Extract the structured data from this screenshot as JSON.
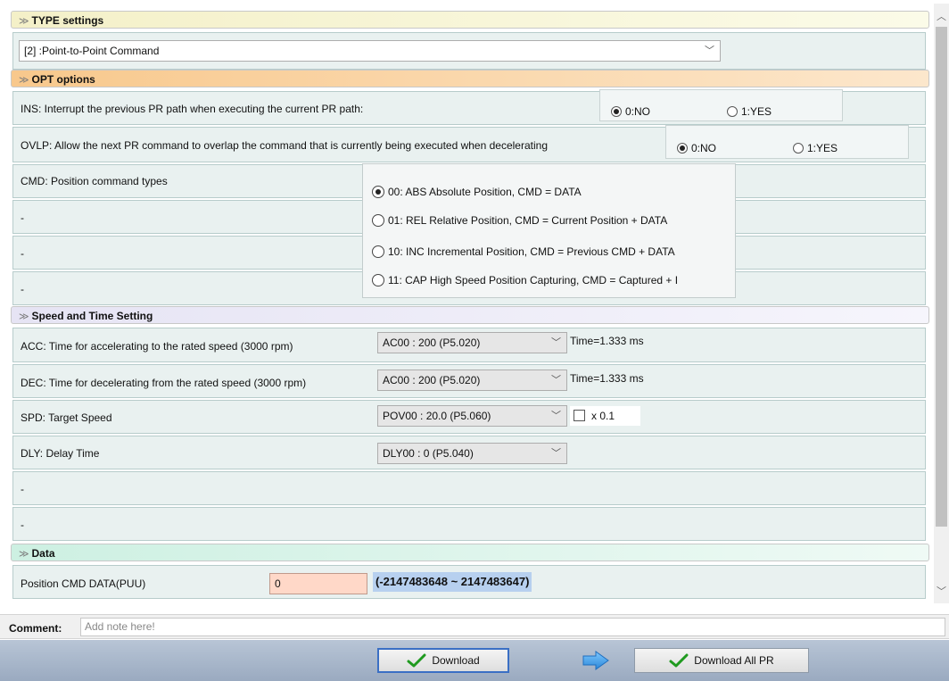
{
  "sections": {
    "type": "TYPE settings",
    "opt": "OPT options",
    "speed": "Speed and Time Setting",
    "data": "Data"
  },
  "type_select": {
    "value": "[2] :Point-to-Point Command"
  },
  "ins": {
    "label": "INS: Interrupt the previous PR path when executing the current PR path:",
    "opt_no": "0:NO",
    "opt_yes": "1:YES",
    "selected": "0:NO"
  },
  "ovlp": {
    "label": "OVLP: Allow the next PR command to overlap the command that is currently being executed when decelerating",
    "opt_no": "0:NO",
    "opt_yes": "1:YES",
    "selected": "0:NO"
  },
  "cmd": {
    "label": "CMD: Position command types",
    "options": [
      "00: ABS Absolute Position, CMD = DATA",
      "01: REL Relative Position, CMD = Current Position + DATA",
      "10: INC Incremental Position, CMD = Previous CMD + DATA",
      "11: CAP High Speed Position Capturing, CMD = Captured + I"
    ],
    "selected_index": 0
  },
  "blank_rows": [
    "-",
    "-",
    "-",
    "-",
    "-"
  ],
  "acc": {
    "label": "ACC: Time for accelerating to the rated speed (3000 rpm)",
    "value": "AC00 : 200 (P5.020)",
    "time": "Time=1.333 ms"
  },
  "dec": {
    "label": "DEC: Time for decelerating from the rated speed (3000 rpm)",
    "value": "AC00 : 200 (P5.020)",
    "time": "Time=1.333 ms"
  },
  "spd": {
    "label": "SPD: Target Speed",
    "value": "POV00 : 20.0 (P5.060)",
    "multiplier": "x 0.1",
    "checked": false
  },
  "dly": {
    "label": "DLY: Delay Time",
    "value": "DLY00 : 0 (P5.040)"
  },
  "data": {
    "label": "Position CMD DATA(PUU)",
    "value": "0",
    "range": "(-2147483648 ~ 2147483647)"
  },
  "comment": {
    "label": "Comment:",
    "placeholder": "Add note here!"
  },
  "buttons": {
    "download": "Download",
    "download_all": "Download All PR"
  },
  "colors": {
    "accent": "#3a6fc4",
    "data_input_bg": "#ffd8c8",
    "range_highlight": "#b7d0ef"
  }
}
